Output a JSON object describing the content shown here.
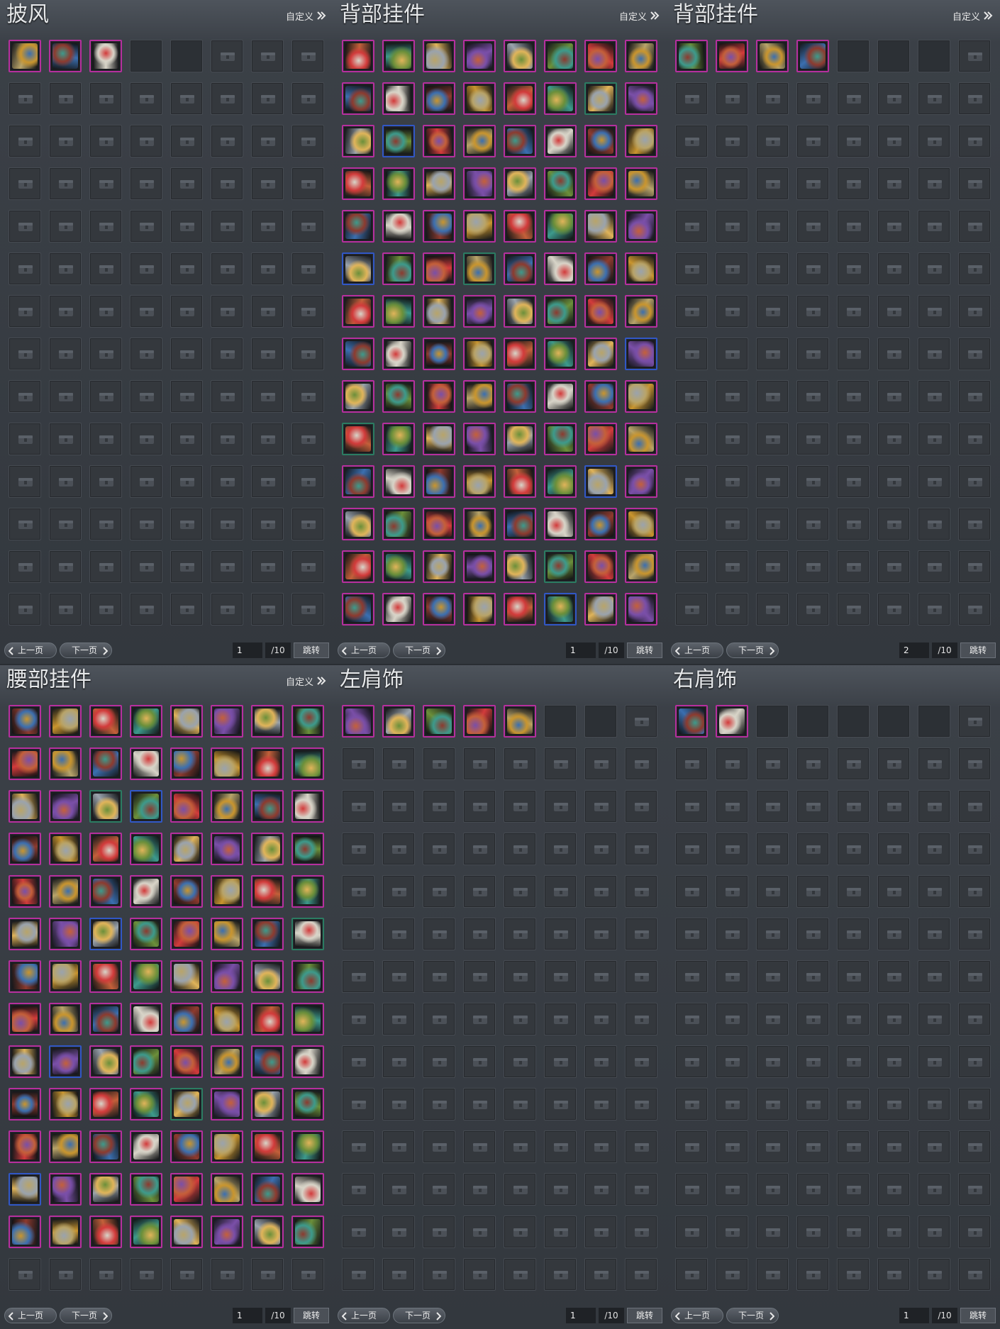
{
  "common": {
    "customize_label": "自定义",
    "prev_label": "上一页",
    "next_label": "下一页",
    "jump_label": "跳转"
  },
  "colors": {
    "panel_bg": "#3b4047",
    "slot_border_rare": "#b62f9e",
    "slot_border_blue": "#3157c6",
    "slot_border_green": "#2b7c62",
    "title_text": "#e6e8ea"
  },
  "panels": [
    {
      "title": "披风",
      "has_customize": true,
      "page": "1",
      "total_label": "/10",
      "filled_count": 3,
      "open_slots": 5
    },
    {
      "title": "背部挂件",
      "has_customize": true,
      "page": "1",
      "total_label": "/10",
      "filled_count": 112,
      "open_slots": 112
    },
    {
      "title": "背部挂件",
      "has_customize": true,
      "page": "2",
      "total_label": "/10",
      "filled_count": 4,
      "open_slots": 7
    },
    {
      "title": "腰部挂件",
      "has_customize": true,
      "page": "1",
      "total_label": "/10",
      "filled_count": 104,
      "open_slots": 104
    },
    {
      "title": "左肩饰",
      "has_customize": false,
      "page": "1",
      "total_label": "/10",
      "filled_count": 5,
      "open_slots": 7
    },
    {
      "title": "右肩饰",
      "has_customize": false,
      "page": "1",
      "total_label": "/10",
      "filled_count": 2,
      "open_slots": 7
    }
  ],
  "grid": {
    "rows": 14,
    "cols": 8
  },
  "icon_palette": [
    "#c9952e",
    "#8d3a2e",
    "#d8d4c8",
    "#3b6fb0",
    "#b8a46a",
    "#d23b3b",
    "#6b8f3a",
    "#9aa3ad",
    "#7a4fa8",
    "#e0b45a",
    "#3d9a8c",
    "#c4603a"
  ]
}
